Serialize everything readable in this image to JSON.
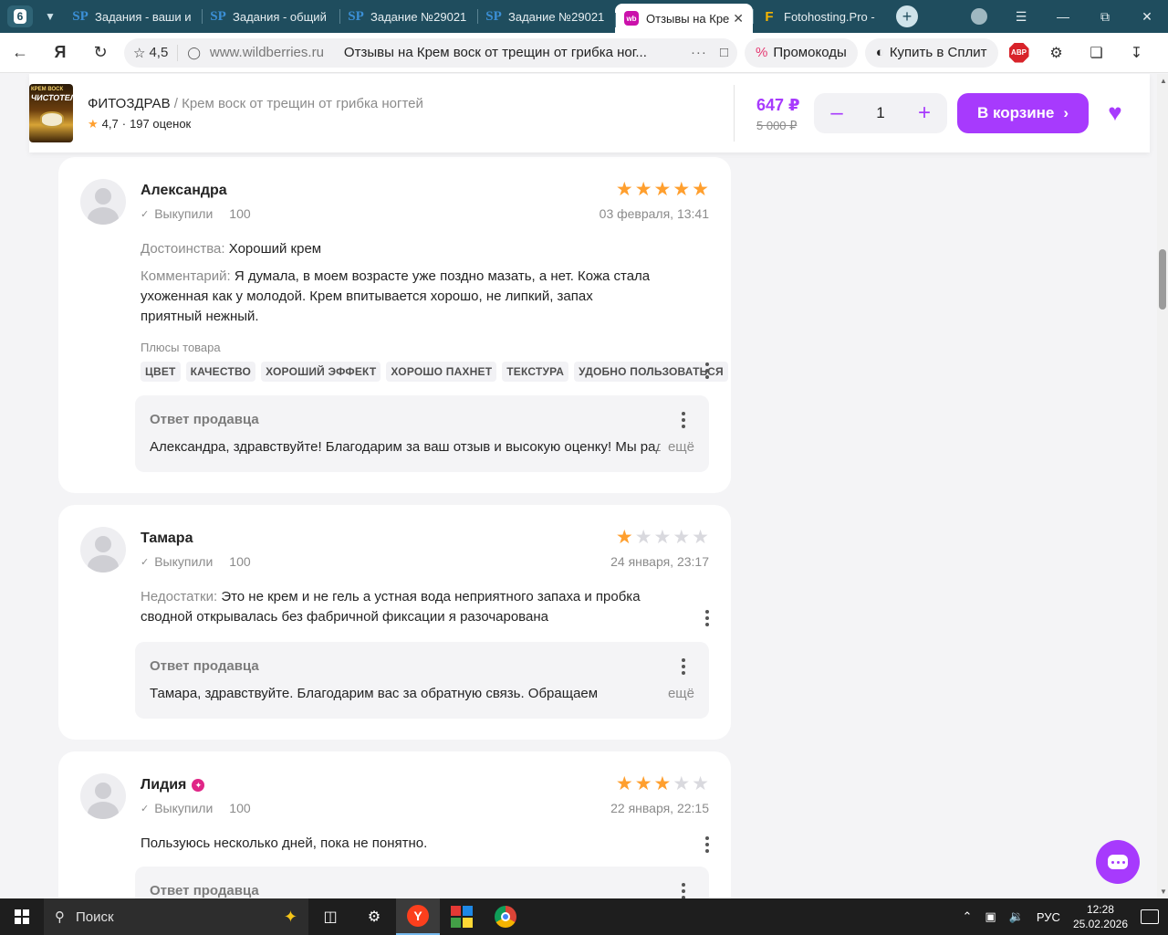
{
  "browser": {
    "tab_count": "6",
    "tabs": [
      {
        "icon": "SP",
        "title": "Задания - ваши и"
      },
      {
        "icon": "SP",
        "title": "Задания - общий"
      },
      {
        "icon": "SP",
        "title": "Задание №29021"
      },
      {
        "icon": "SP",
        "title": "Задание №29021"
      },
      {
        "icon": "wb",
        "title": "Отзывы на Кре"
      },
      {
        "icon": "F",
        "title": "Fotohosting.Pro -"
      }
    ],
    "address": {
      "rating": "4,5",
      "domain": "www.wildberries.ru",
      "page_title": "Отзывы на Крем воск от трещин от грибка ног...",
      "more": "···"
    },
    "promo_label": "Промокоды",
    "split_label": "Купить в Сплит",
    "abp_label": "ABP"
  },
  "product": {
    "brand": "ФИТОЗДРАВ",
    "separator": "/",
    "name": "Крем воск от трещин от грибка ногтей",
    "rating": "4,7",
    "rating_sep": "·",
    "reviews_count": "197 оценок",
    "thumb_text_top": "КРЕМ ВОСК",
    "thumb_text_main": "ЧИСТОТЕЛ",
    "price": "647 ₽",
    "old_price": "5 000 ₽",
    "quantity": "1",
    "cart_label": "В корзине",
    "accent": "#a73afd"
  },
  "reviews": [
    {
      "author": "Александра",
      "bought_label": "Выкупили",
      "bought_count": "100",
      "rating": 5,
      "date": "03 февраля, 13:41",
      "pros_label": "Достоинства:",
      "pros": "Хороший крем",
      "comment_label": "Комментарий:",
      "comment": "Я думала, в моем возрасте уже поздно мазать, а нет. Кожа стала ухоженная как у молодой. Крем впитывается хорошо, не липкий, запах приятный нежный.",
      "tags_title": "Плюсы товара",
      "tags": [
        "ЦВЕТ",
        "КАЧЕСТВО",
        "ХОРОШИЙ ЭФФЕКТ",
        "ХОРОШО ПАХНЕТ",
        "ТЕКСТУРА",
        "УДОБНО ПОЛЬЗОВАТЬСЯ"
      ],
      "seller_title": "Ответ продавца",
      "seller_text": "Александра, здравствуйте! Благодарим за ваш отзыв и высокую оценку! Мы рады",
      "more": "ещё"
    },
    {
      "author": "Тамара",
      "bought_label": "Выкупили",
      "bought_count": "100",
      "rating": 1,
      "date": "24 января, 23:17",
      "cons_label": "Недостатки:",
      "cons": "Это не крем и не гель а устная вода неприятного запаха и пробка сводной открывалась без фабричной фиксации я разочарована",
      "seller_title": "Ответ продавца",
      "seller_text": "Тамара, здравствуйте. Благодарим вас за обратную связь. Обращаем",
      "more": "ещё"
    },
    {
      "author": "Лидия",
      "bought_label": "Выкупили",
      "bought_count": "100",
      "rating": 3,
      "date": "22 января, 22:15",
      "text": "Пользуюсь несколько дней, пока не понятно.",
      "seller_title": "Ответ продавца"
    }
  ],
  "taskbar": {
    "search_label": "Поиск",
    "lang": "РУС",
    "time": "12:28",
    "date": "25.02.2026"
  }
}
